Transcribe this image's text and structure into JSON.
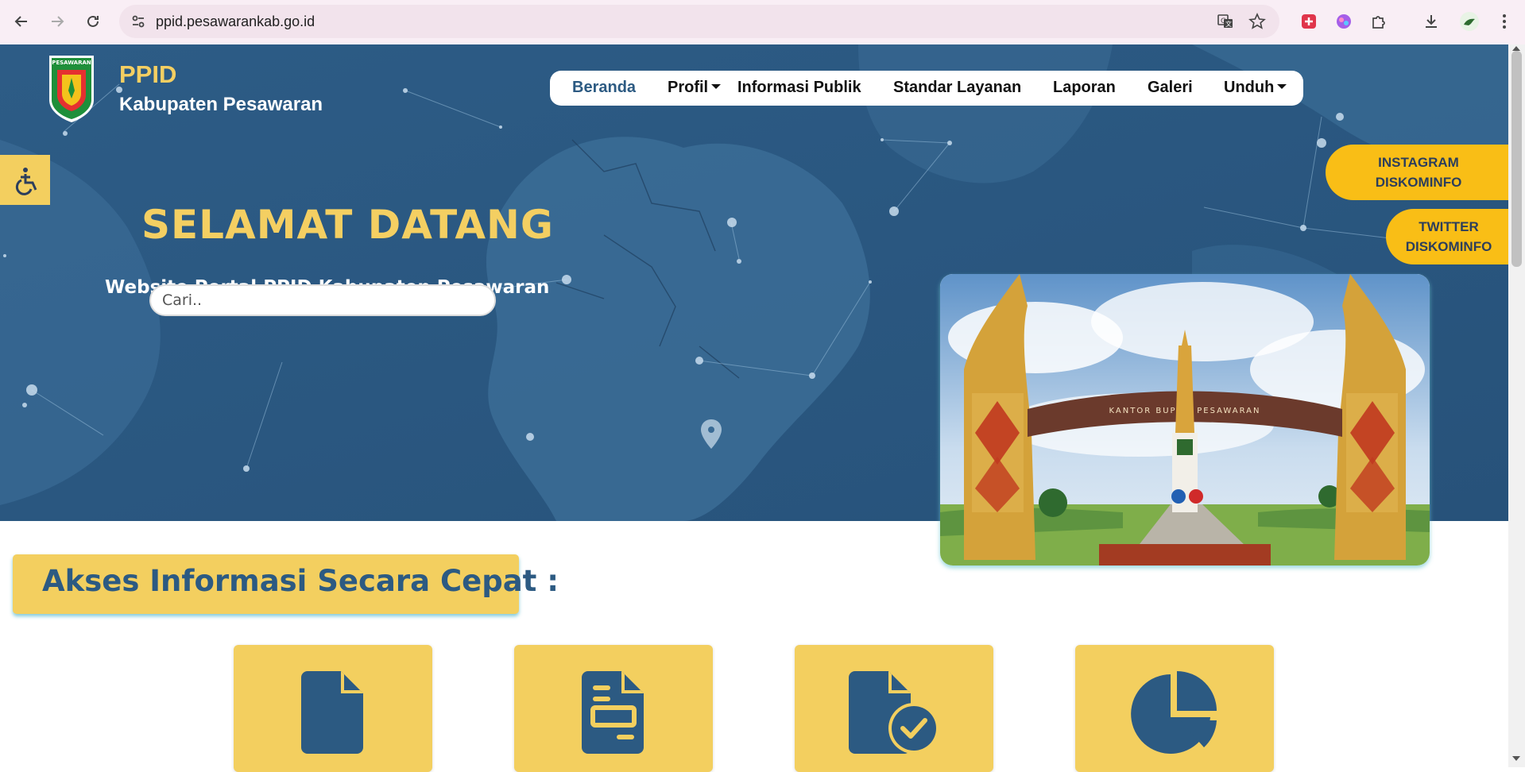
{
  "browser": {
    "url": "ppid.pesawarankab.go.id"
  },
  "header": {
    "brand_title": "PPID",
    "brand_subtitle": "Kabupaten Pesawaran",
    "logo_text": "PESAWARAN"
  },
  "nav": {
    "items": [
      {
        "label": "Beranda",
        "active": true
      },
      {
        "label": "Profil",
        "dropdown": true
      },
      {
        "label": "Informasi Publik"
      },
      {
        "label": "Standar Layanan"
      },
      {
        "label": "Laporan"
      },
      {
        "label": "Galeri"
      },
      {
        "label": "Unduh",
        "dropdown": true
      }
    ]
  },
  "hero": {
    "welcome": "SELAMAT DATANG",
    "subtitle": "Website Portal PPID Kabupaten Pesawaran",
    "search_placeholder": "Cari..",
    "photo_sign": "KANTOR BUPATI PESAWARAN"
  },
  "social": {
    "instagram": "INSTAGRAM DISKOMINFO",
    "twitter": "TWITTER DISKOMINFO"
  },
  "quick_access": {
    "title": "Akses Informasi Secara Cepat :",
    "cards": [
      {
        "icon": "file-icon"
      },
      {
        "icon": "document-lines-icon"
      },
      {
        "icon": "file-check-icon"
      },
      {
        "icon": "pie-chart-icon"
      }
    ]
  },
  "colors": {
    "primary": "#2c5a82",
    "accent": "#f3cf5f",
    "social": "#f9be16"
  }
}
